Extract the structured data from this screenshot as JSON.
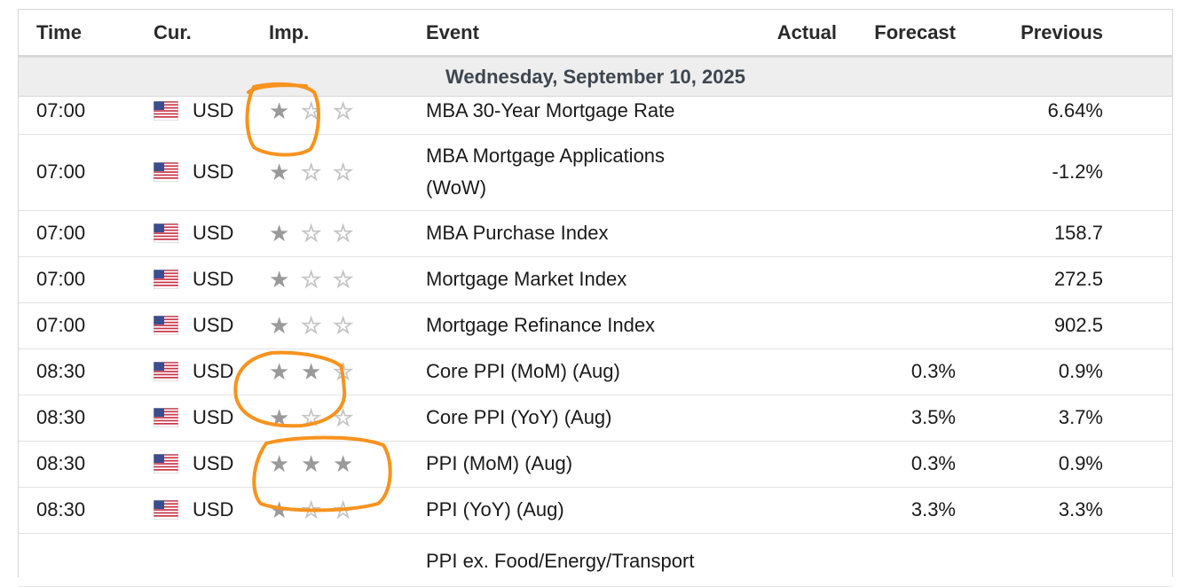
{
  "headers": {
    "time": "Time",
    "currency": "Cur.",
    "importance": "Imp.",
    "event": "Event",
    "actual": "Actual",
    "forecast": "Forecast",
    "previous": "Previous"
  },
  "day_label": "Wednesday, September 10, 2025",
  "rows": [
    {
      "time": "07:00",
      "currency": "USD",
      "importance": 1,
      "event": "MBA 30-Year Mortgage Rate",
      "actual": "",
      "forecast": "",
      "previous": "6.64%"
    },
    {
      "time": "07:00",
      "currency": "USD",
      "importance": 1,
      "event": "MBA Mortgage Applications (WoW)",
      "actual": "",
      "forecast": "",
      "previous": "-1.2%"
    },
    {
      "time": "07:00",
      "currency": "USD",
      "importance": 1,
      "event": "MBA Purchase Index",
      "actual": "",
      "forecast": "",
      "previous": "158.7"
    },
    {
      "time": "07:00",
      "currency": "USD",
      "importance": 1,
      "event": "Mortgage Market Index",
      "actual": "",
      "forecast": "",
      "previous": "272.5"
    },
    {
      "time": "07:00",
      "currency": "USD",
      "importance": 1,
      "event": "Mortgage Refinance Index",
      "actual": "",
      "forecast": "",
      "previous": "902.5"
    },
    {
      "time": "08:30",
      "currency": "USD",
      "importance": 2,
      "event": "Core PPI (MoM) (Aug)",
      "actual": "",
      "forecast": "0.3%",
      "previous": "0.9%"
    },
    {
      "time": "08:30",
      "currency": "USD",
      "importance": 1,
      "event": "Core PPI (YoY) (Aug)",
      "actual": "",
      "forecast": "3.5%",
      "previous": "3.7%"
    },
    {
      "time": "08:30",
      "currency": "USD",
      "importance": 3,
      "event": "PPI (MoM) (Aug)",
      "actual": "",
      "forecast": "0.3%",
      "previous": "0.9%"
    },
    {
      "time": "08:30",
      "currency": "USD",
      "importance": 1,
      "event": "PPI (YoY) (Aug)",
      "actual": "",
      "forecast": "3.3%",
      "previous": "3.3%"
    },
    {
      "time": "",
      "currency": "",
      "importance": null,
      "event": "PPI ex. Food/Energy/Transport",
      "actual": "",
      "forecast": "",
      "previous": ""
    }
  ],
  "colors": {
    "star_on": "#9a9a9a",
    "star_off": "#c4c4c4",
    "annotation": "#f7931e",
    "day_bar": "#eeeeee"
  },
  "icons": {
    "flag": "us-flag-icon",
    "star_filled": "star-filled-icon",
    "star_empty": "star-empty-icon"
  }
}
